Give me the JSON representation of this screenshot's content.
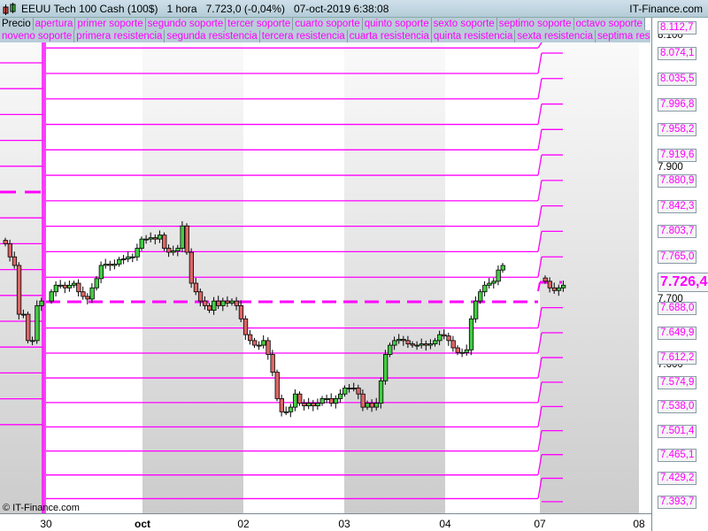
{
  "header": {
    "instrument": "EEUU Tech 100 Cash (100$)",
    "timeframe": "1 hora",
    "price": "7.723,0 (-0,04%)",
    "datetime": "07-oct-2019 6:38:08",
    "brand": "IT-Finance.com"
  },
  "legend_row1": [
    "Precio",
    "apertura",
    "primer soporte",
    "segundo soporte",
    "tercer soporte",
    "cuarto soporte",
    "quinto soporte",
    "sexto soporte",
    "septimo soporte",
    "octavo soporte"
  ],
  "legend_row2": [
    "noveno soporte",
    "primera resistencia",
    "segunda resistencia",
    "tercera resistencia",
    "cuarta resistencia",
    "quinta resistencia",
    "sexta resistencia",
    "septima resistencia"
  ],
  "levels": [
    "8.112,7",
    "8.074,1",
    "8.035,5",
    "7.996,8",
    "7.958,2",
    "7.919,6",
    "7.880,9",
    "7.842,3",
    "7.803,7",
    "7.765,0",
    "7.726,4",
    "7.688,0",
    "7.649,9",
    "7.612,2",
    "7.574,9",
    "7.538,0",
    "7.501,4",
    "7.465,1",
    "7.429,2",
    "7.393,7"
  ],
  "current_level": "7.726,4",
  "ticks": [
    "8.100",
    "7.900",
    "7.700",
    "7.600"
  ],
  "dates": [
    "30",
    "oct",
    "02",
    "03",
    "04",
    "07",
    "08"
  ],
  "copyright": "© IT-Finance.com",
  "colors": {
    "level": "#ff00ff",
    "up": "#44cc44",
    "down": "#dd6666"
  },
  "chart_data": {
    "type": "candlestick",
    "closes_pre": [
      7785,
      7765,
      7752,
      7678,
      7678,
      7638,
      7638,
      7691,
      7698
    ],
    "closes": [
      7712,
      7722,
      7722,
      7718,
      7722,
      7725,
      7712,
      7705,
      7701,
      7718,
      7732,
      7752,
      7754,
      7752,
      7754,
      7761,
      7762,
      7765,
      7765,
      7778,
      7792,
      7792,
      7794,
      7792,
      7798,
      7778,
      7772,
      7774,
      7778,
      7812,
      7772,
      7725,
      7712,
      7698,
      7691,
      7684,
      7698,
      7691,
      7698,
      7695,
      7698,
      7691,
      7671,
      7647,
      7638,
      7631,
      7631,
      7638,
      7617,
      7590,
      7550,
      7530,
      7530,
      7537,
      7557,
      7543,
      7539,
      7543,
      7539,
      7543,
      7550,
      7550,
      7543,
      7550,
      7557,
      7566,
      7566,
      7566,
      7557,
      7537,
      7543,
      7537,
      7543,
      7577,
      7617,
      7631,
      7638,
      7640,
      7638,
      7633,
      7631,
      7631,
      7633,
      7631,
      7633,
      7638,
      7647,
      7645,
      7638,
      7627,
      7620,
      7620,
      7624,
      7671,
      7698,
      7712,
      7722,
      7725,
      7728,
      7745,
      7752
    ],
    "closes_last": [
      7728,
      7718,
      7714,
      7718,
      7722
    ]
  }
}
